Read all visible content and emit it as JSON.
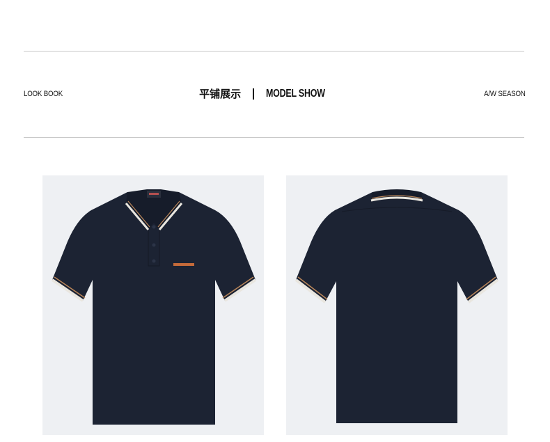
{
  "header": {
    "left_label": "LOOK BOOK",
    "center_title_cn": "平铺展示",
    "center_title_en": "MODEL SHOW",
    "right_label": "A/W SEASON"
  },
  "gallery": {
    "items": [
      {
        "name": "front",
        "garment": "polo shirt front view",
        "color": "#1c2333",
        "trim": [
          "#e9e6df",
          "#b9865a",
          "#ffffff"
        ]
      },
      {
        "name": "back",
        "garment": "polo shirt back view",
        "color": "#1c2333",
        "trim": [
          "#e9e6df",
          "#b9865a",
          "#ffffff"
        ]
      }
    ]
  },
  "colors": {
    "background": "#ffffff",
    "rule": "#c9c9c9",
    "photo_bg": "#eef0f3",
    "shirt": "#1c2333"
  }
}
